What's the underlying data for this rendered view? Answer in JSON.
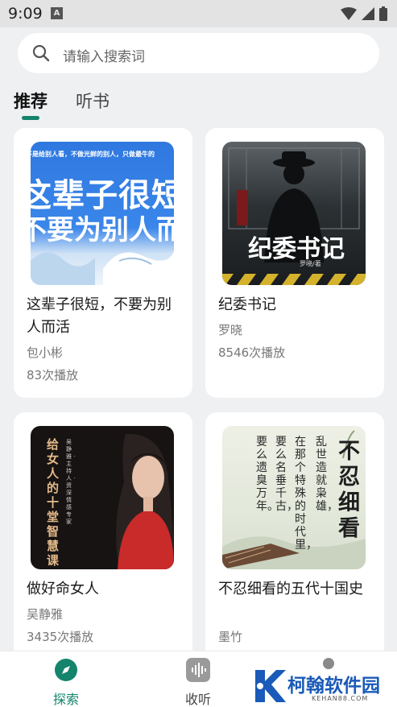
{
  "status_bar": {
    "time": "9:09",
    "notification_letter": "A"
  },
  "search": {
    "placeholder": "请输入搜索词"
  },
  "tabs": [
    {
      "label": "推荐"
    },
    {
      "label": "听书"
    }
  ],
  "books": [
    {
      "title": "这辈子很短，不要为别人而活",
      "author": "包小彬",
      "plays": "83次播放",
      "cover_top_line": "不是给别人看，不做光鲜的别人，只做最牛的",
      "cover_line1": "这辈子很短",
      "cover_line2": "不要为别人而"
    },
    {
      "title": "纪委书记",
      "author": "罗晓",
      "plays": "8546次播放",
      "cover_title": "纪委书记",
      "cover_author": "罗晓/著"
    },
    {
      "title": "做好命女人",
      "author": "吴静雅",
      "plays": "3435次播放",
      "cover_title": "给女人的十堂智慧课",
      "cover_credit": "吴静雅 · 主持人 · 资深情感专家"
    },
    {
      "title": "不忍细看的五代十国史",
      "author": "墨竹",
      "plays": "",
      "cover_title": "不忍细看",
      "cover_col1": "乱世造就枭雄，",
      "cover_col2": "在那个特殊的时代里，",
      "cover_col3": "要么名垂千古，",
      "cover_col4": "要么遗臭万年。"
    }
  ],
  "bottom_nav": [
    {
      "label": "探索",
      "icon": "compass-icon",
      "active": true
    },
    {
      "label": "收听",
      "icon": "waveform-icon",
      "active": false
    }
  ],
  "watermark": {
    "text": "柯翰软件园",
    "sub": "KEHAN88.COM"
  },
  "colors": {
    "accent": "#14846c",
    "background": "#eef0f2",
    "watermark": "#1a5ab8"
  }
}
